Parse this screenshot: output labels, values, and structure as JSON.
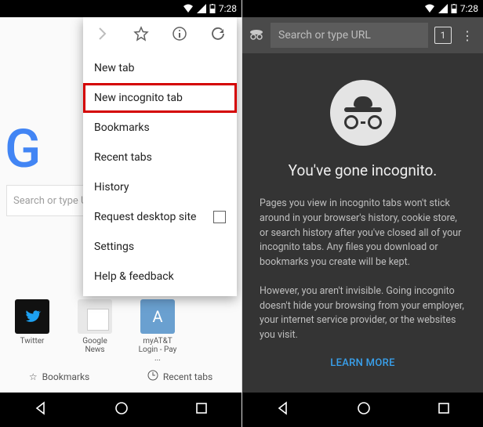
{
  "status": {
    "time": "7:28"
  },
  "left": {
    "search_placeholder": "Search or type U",
    "big_g": "G",
    "shortcuts": [
      {
        "label": "Twitter"
      },
      {
        "label": "Google News"
      },
      {
        "label": "myAT&T Login - Pay ..."
      }
    ],
    "bottom": {
      "bookmarks": "Bookmarks",
      "recent": "Recent tabs"
    },
    "menu": {
      "items": [
        "New tab",
        "New incognito tab",
        "Bookmarks",
        "Recent tabs",
        "History",
        "Request desktop site",
        "Settings",
        "Help & feedback"
      ],
      "highlight_index": 1
    }
  },
  "right": {
    "omnibox_placeholder": "Search or type URL",
    "tab_count": "1",
    "title": "You've gone incognito.",
    "para1": "Pages you view in incognito tabs won't stick around in your browser's history, cookie store, or search history after you've closed all of your incognito tabs. Any files you download or bookmarks you create will be kept.",
    "para2": "However, you aren't invisible. Going incognito doesn't hide your browsing from your employer, your internet service provider, or the websites you visit.",
    "learn_more": "LEARN MORE"
  }
}
